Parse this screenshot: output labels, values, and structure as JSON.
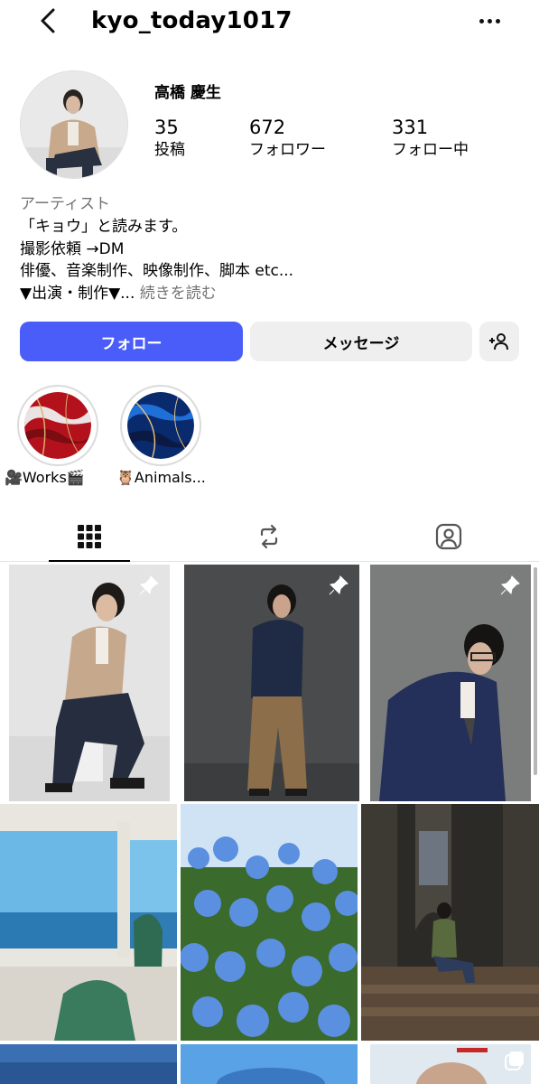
{
  "header": {
    "username": "kyo_today1017",
    "back_icon": "chevron-left-icon",
    "more_icon": "more-horizontal-icon"
  },
  "profile": {
    "full_name": "高橋 慶生",
    "stats": [
      {
        "count": "35",
        "label": "投稿"
      },
      {
        "count": "672",
        "label": "フォロワー"
      },
      {
        "count": "331",
        "label": "フォロー中"
      }
    ],
    "bio": {
      "category": "アーティスト",
      "lines": [
        "「キョウ」と読みます。",
        "撮影依頼 →DM",
        "俳優、音楽制作、映像制作、脚本 etc...",
        "▼出演・制作▼..."
      ],
      "more_label": "続きを読む"
    }
  },
  "actions": {
    "follow_label": "フォロー",
    "message_label": "メッセージ",
    "follow_color": "#4a5df9",
    "suggest_icon": "add-person-icon"
  },
  "highlights": [
    {
      "label": "🎥Works🎬"
    },
    {
      "label": "🦉Animals..."
    }
  ],
  "tabs": [
    {
      "icon": "grid-icon",
      "active": true
    },
    {
      "icon": "reels-repost-icon",
      "active": false
    },
    {
      "icon": "tagged-person-icon",
      "active": false
    }
  ]
}
